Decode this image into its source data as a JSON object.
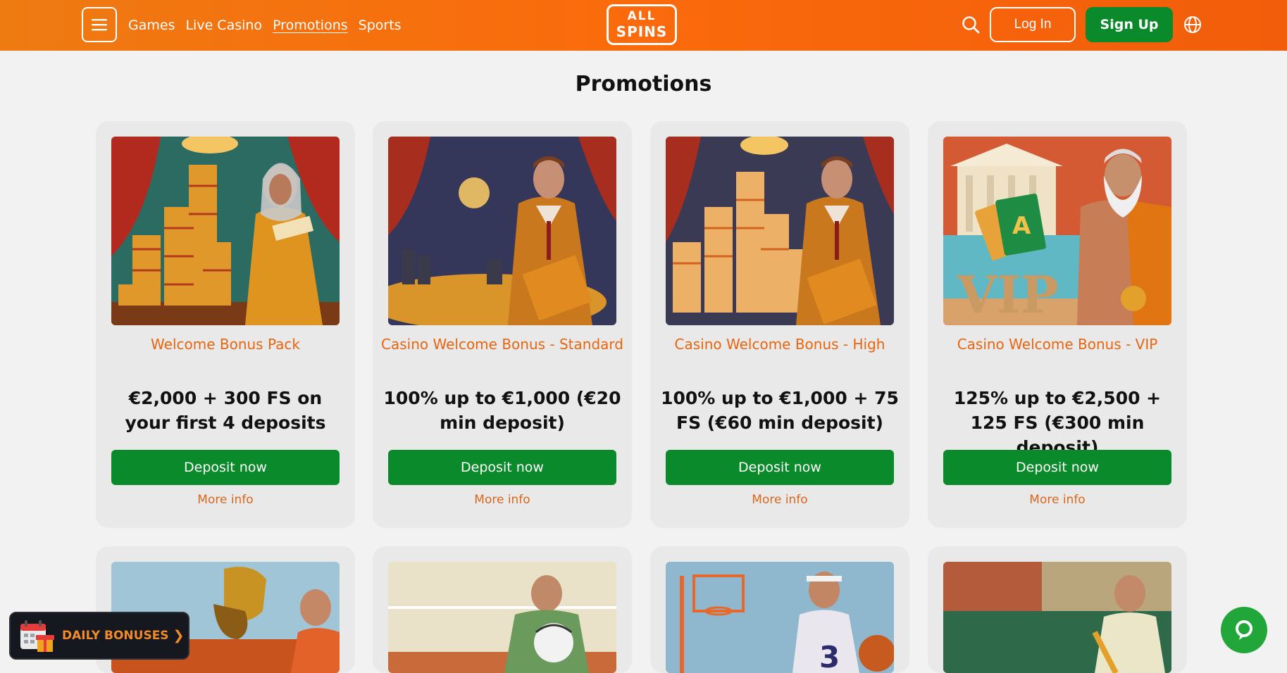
{
  "header": {
    "nav": [
      "Games",
      "Live Casino",
      "Promotions",
      "Sports"
    ],
    "logo": {
      "top": "ALL",
      "bottom": "SPINS"
    },
    "login_label": "Log In",
    "signup_label": "Sign Up",
    "icons": {
      "menu": "hamburger-icon",
      "search": "search-icon",
      "language": "globe-icon"
    }
  },
  "page": {
    "title": "Promotions"
  },
  "promotions": [
    {
      "title": "Welcome Bonus Pack",
      "offer": "€2,000 + 300 FS on your first 4 deposits",
      "cta": "Deposit now",
      "more": "More info"
    },
    {
      "title": "Casino Welcome Bonus - Standard",
      "offer": "100% up to €1,000 (€20 min deposit)",
      "cta": "Deposit now",
      "more": "More info"
    },
    {
      "title": "Casino Welcome Bonus - High",
      "offer": "100% up to €1,000 + 75 FS (€60 min deposit)",
      "cta": "Deposit now",
      "more": "More info"
    },
    {
      "title": "Casino Welcome Bonus - VIP",
      "offer": "125% up to €2,500 + 125 FS (€300 min deposit)",
      "cta": "Deposit now",
      "more": "More info"
    }
  ],
  "image_texts": {
    "vip": "VIP",
    "card_letter": "A",
    "jersey_number": "3"
  },
  "daily_bonuses": {
    "label": "DAILY BONUSES",
    "icon": "calendar-gift-icon"
  },
  "chat": {
    "icon": "chat-icon"
  },
  "colors": {
    "header": "#fb6a0c",
    "accent": "#e8650e",
    "cta": "#0a8a2a",
    "background": "#f2f2f2"
  }
}
